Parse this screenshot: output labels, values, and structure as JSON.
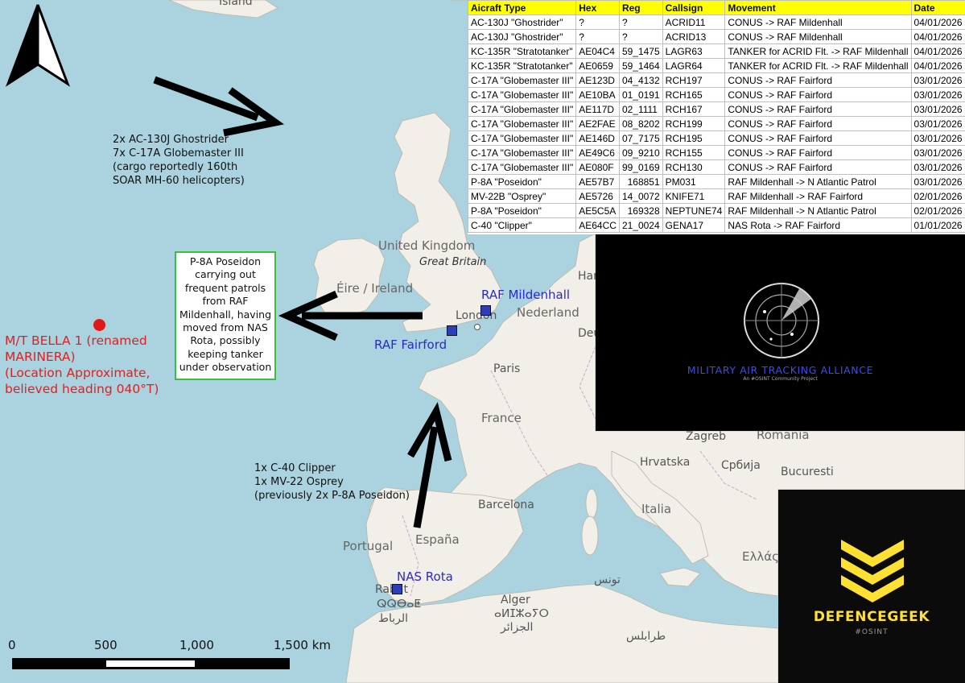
{
  "map": {
    "places": [
      {
        "name": "Island",
        "kind": "place"
      },
      {
        "name": "United Kingdom",
        "kind": "big"
      },
      {
        "name": "Great Britain",
        "kind": "it"
      },
      {
        "name": "Éire / Ireland",
        "kind": "big"
      },
      {
        "name": "London",
        "kind": "place"
      },
      {
        "name": "Nederland",
        "kind": "big"
      },
      {
        "name": "Paris",
        "kind": "place"
      },
      {
        "name": "France",
        "kind": "big"
      },
      {
        "name": "Zagreb",
        "kind": "place"
      },
      {
        "name": "Hrvatska",
        "kind": "place"
      },
      {
        "name": "Србија",
        "kind": "place"
      },
      {
        "name": "Romania",
        "kind": "big"
      },
      {
        "name": "Bucuresti",
        "kind": "place"
      },
      {
        "name": "Barcelona",
        "kind": "place"
      },
      {
        "name": "Italia",
        "kind": "big"
      },
      {
        "name": "España",
        "kind": "big"
      },
      {
        "name": "Portugal",
        "kind": "big"
      },
      {
        "name": "Alger",
        "kind": "place"
      },
      {
        "name": "Ελλάς",
        "kind": "big"
      },
      {
        "name": "Ham",
        "kind": "place"
      },
      {
        "name": "Deu",
        "kind": "place"
      },
      {
        "name": "ⴰⵍⵊⵣⴰⵢⵔ",
        "kind": "place"
      },
      {
        "name": "الجزائر",
        "kind": "place"
      },
      {
        "name": "تونس",
        "kind": "place"
      },
      {
        "name": "طرابلس",
        "kind": "place"
      },
      {
        "name": "ⵕⵕⴱⴰⵟ",
        "kind": "place"
      },
      {
        "name": "الرباط",
        "kind": "place"
      },
      {
        "name": "Rabat",
        "kind": "place"
      }
    ],
    "bases": [
      {
        "name": "RAF Mildenhall"
      },
      {
        "name": "RAF Fairford"
      },
      {
        "name": "NAS Rota"
      }
    ],
    "notes": {
      "north_atlantic": [
        "2x AC-130J Ghostrider",
        "7x C-17A Globemaster III",
        "(cargo reportedly 160th",
        "SOAR MH-60 helicopters)"
      ],
      "rota": [
        "1x C-40 Clipper",
        "1x MV-22 Osprey",
        "(previously 2x P-8A Poseidon)"
      ],
      "p8_box": [
        "P-8A Poseidon",
        "carrying out",
        "frequent patrols",
        "from RAF",
        "Mildenhall, having",
        "moved from NAS",
        "Rota, possibly",
        "keeping tanker",
        "under observation"
      ],
      "vessel": [
        "M/T BELLA 1 (renamed",
        "MARINERA)",
        "(Location Approximate,",
        "believed heading 040°T)"
      ]
    },
    "scale": {
      "labels": [
        "0",
        "500",
        "1,000",
        "1,500 km"
      ]
    },
    "colors": {
      "sea": "#aad3df",
      "land": "#f2efe9",
      "vessel": "#e02020",
      "base": "#2c3fb8",
      "box_border": "#3cbf3c",
      "header": "#ffff00"
    },
    "compass_icon": "north-arrow-icon"
  },
  "table": {
    "headers": [
      "Aicraft Type",
      "Hex",
      "Reg",
      "Callsign",
      "Movement",
      "Date"
    ],
    "rows": [
      [
        "AC-130J \"Ghostrider\"",
        "?",
        "?",
        "ACRID11",
        "CONUS -> RAF Mildenhall",
        "04/01/2026"
      ],
      [
        "AC-130J \"Ghostrider\"",
        "?",
        "?",
        "ACRID13",
        "CONUS -> RAF Mildenhall",
        "04/01/2026"
      ],
      [
        "KC-135R \"Stratotanker\"",
        "AE04C4",
        "59_1475",
        "LAGR63",
        "TANKER for ACRID Flt. -> RAF Mildenhall",
        "04/01/2026"
      ],
      [
        "KC-135R \"Stratotanker\"",
        "AE0659",
        "59_1464",
        "LAGR64",
        "TANKER for ACRID Flt. -> RAF Mildenhall",
        "04/01/2026"
      ],
      [
        "C-17A \"Globemaster III\"",
        "AE123D",
        "04_4132",
        "RCH197",
        "CONUS -> RAF Fairford",
        "03/01/2026"
      ],
      [
        "C-17A \"Globemaster III\"",
        "AE10BA",
        "01_0191",
        "RCH165",
        "CONUS -> RAF Fairford",
        "03/01/2026"
      ],
      [
        "C-17A \"Globemaster III\"",
        "AE117D",
        "02_1111",
        "RCH167",
        "CONUS -> RAF Fairford",
        "03/01/2026"
      ],
      [
        "C-17A \"Globemaster III\"",
        "AE2FAE",
        "08_8202",
        "RCH199",
        "CONUS -> RAF Fairford",
        "03/01/2026"
      ],
      [
        "C-17A \"Globemaster III\"",
        "AE146D",
        "07_7175",
        "RCH195",
        "CONUS -> RAF Fairford",
        "03/01/2026"
      ],
      [
        "C-17A \"Globemaster III\"",
        "AE49C6",
        "09_9210",
        "RCH155",
        "CONUS -> RAF Fairford",
        "03/01/2026"
      ],
      [
        "C-17A \"Globemaster III\"",
        "AE080F",
        "99_0169",
        "RCH130",
        "CONUS -> RAF Fairford",
        "03/01/2026"
      ],
      [
        "P-8A \"Poseidon\"",
        "AE57B7",
        "168851",
        "PM031",
        "RAF Mildenhall -> N Atlantic Patrol",
        "03/01/2026"
      ],
      [
        "MV-22B \"Osprey\"",
        "AE5726",
        "14_0072",
        "KNIFE71",
        "RAF Mildenhall -> RAF Fairford",
        "02/01/2026"
      ],
      [
        "P-8A \"Poseidon\"",
        "AE5C5A",
        "169328",
        "NEPTUNE74",
        "RAF Mildenhall -> N Atlantic Patrol",
        "02/01/2026"
      ],
      [
        "C-40 \"Clipper\"",
        "AE64CC",
        "21_0024",
        "GENA17",
        "NAS Rota -> RAF Fairford",
        "01/01/2026"
      ]
    ]
  },
  "logos": {
    "mata": {
      "title": "MILITARY AIR TRACKING ALLIANCE",
      "subtitle": "An #OSINT Community Project",
      "icon": "radar-icon"
    },
    "defencegeek": {
      "title": "DEFENCEGEEK",
      "subtitle": "#OSINT",
      "icon": "chevrons-icon"
    }
  }
}
